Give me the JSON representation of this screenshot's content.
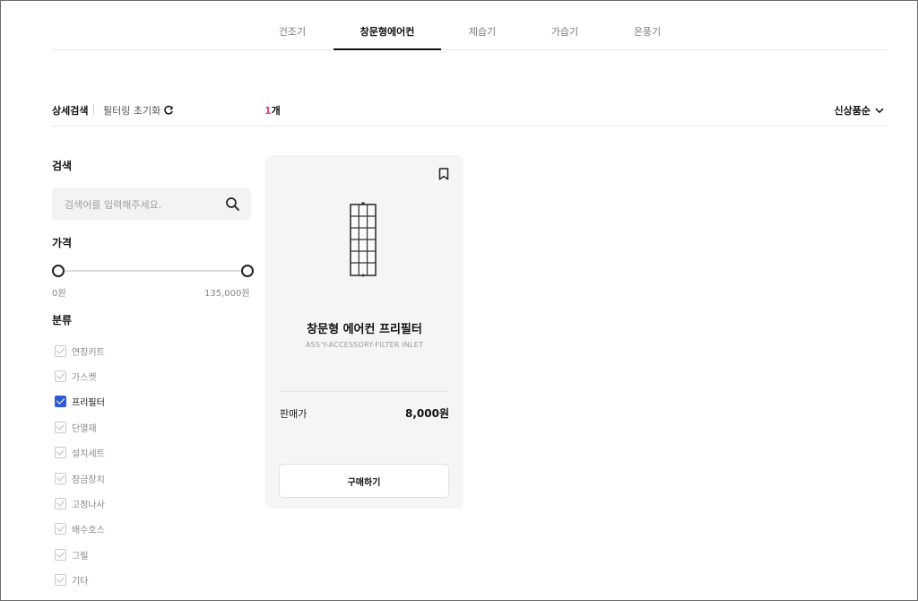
{
  "tabs": [
    {
      "label": "건조기",
      "active": false
    },
    {
      "label": "창문형에어컨",
      "active": true
    },
    {
      "label": "제습기",
      "active": false
    },
    {
      "label": "가습기",
      "active": false
    },
    {
      "label": "온풍기",
      "active": false
    }
  ],
  "filter_bar": {
    "detail_search_label": "상세검색",
    "reset_label": "필터링 초기화",
    "result_count": "1",
    "result_unit": "개",
    "sort_label": "신상품순"
  },
  "sidebar": {
    "search": {
      "title": "검색",
      "placeholder": "검색어를 입력해주세요."
    },
    "price": {
      "title": "가격",
      "min_label": "0원",
      "max_label": "135,000원"
    },
    "category": {
      "title": "분류",
      "items": [
        {
          "label": "연장키트",
          "checked": false
        },
        {
          "label": "가스켓",
          "checked": false
        },
        {
          "label": "프리필터",
          "checked": true
        },
        {
          "label": "단열재",
          "checked": false
        },
        {
          "label": "설치세트",
          "checked": false
        },
        {
          "label": "잠금장치",
          "checked": false
        },
        {
          "label": "고정나사",
          "checked": false
        },
        {
          "label": "배수호스",
          "checked": false
        },
        {
          "label": "그릴",
          "checked": false
        },
        {
          "label": "기타",
          "checked": false
        }
      ]
    }
  },
  "product": {
    "name": "창문형 에어컨 프리필터",
    "code": "ASS'Y-ACCESSORY-FILTER INLET",
    "price_label": "판매가",
    "price": "8,000원",
    "buy_label": "구매하기"
  },
  "colors": {
    "accent_count": "#e0447f",
    "checkbox_checked": "#2f5bd9"
  },
  "icons": [
    "refresh-icon",
    "chevron-down-icon",
    "search-icon",
    "bookmark-icon",
    "filter-product-image"
  ]
}
